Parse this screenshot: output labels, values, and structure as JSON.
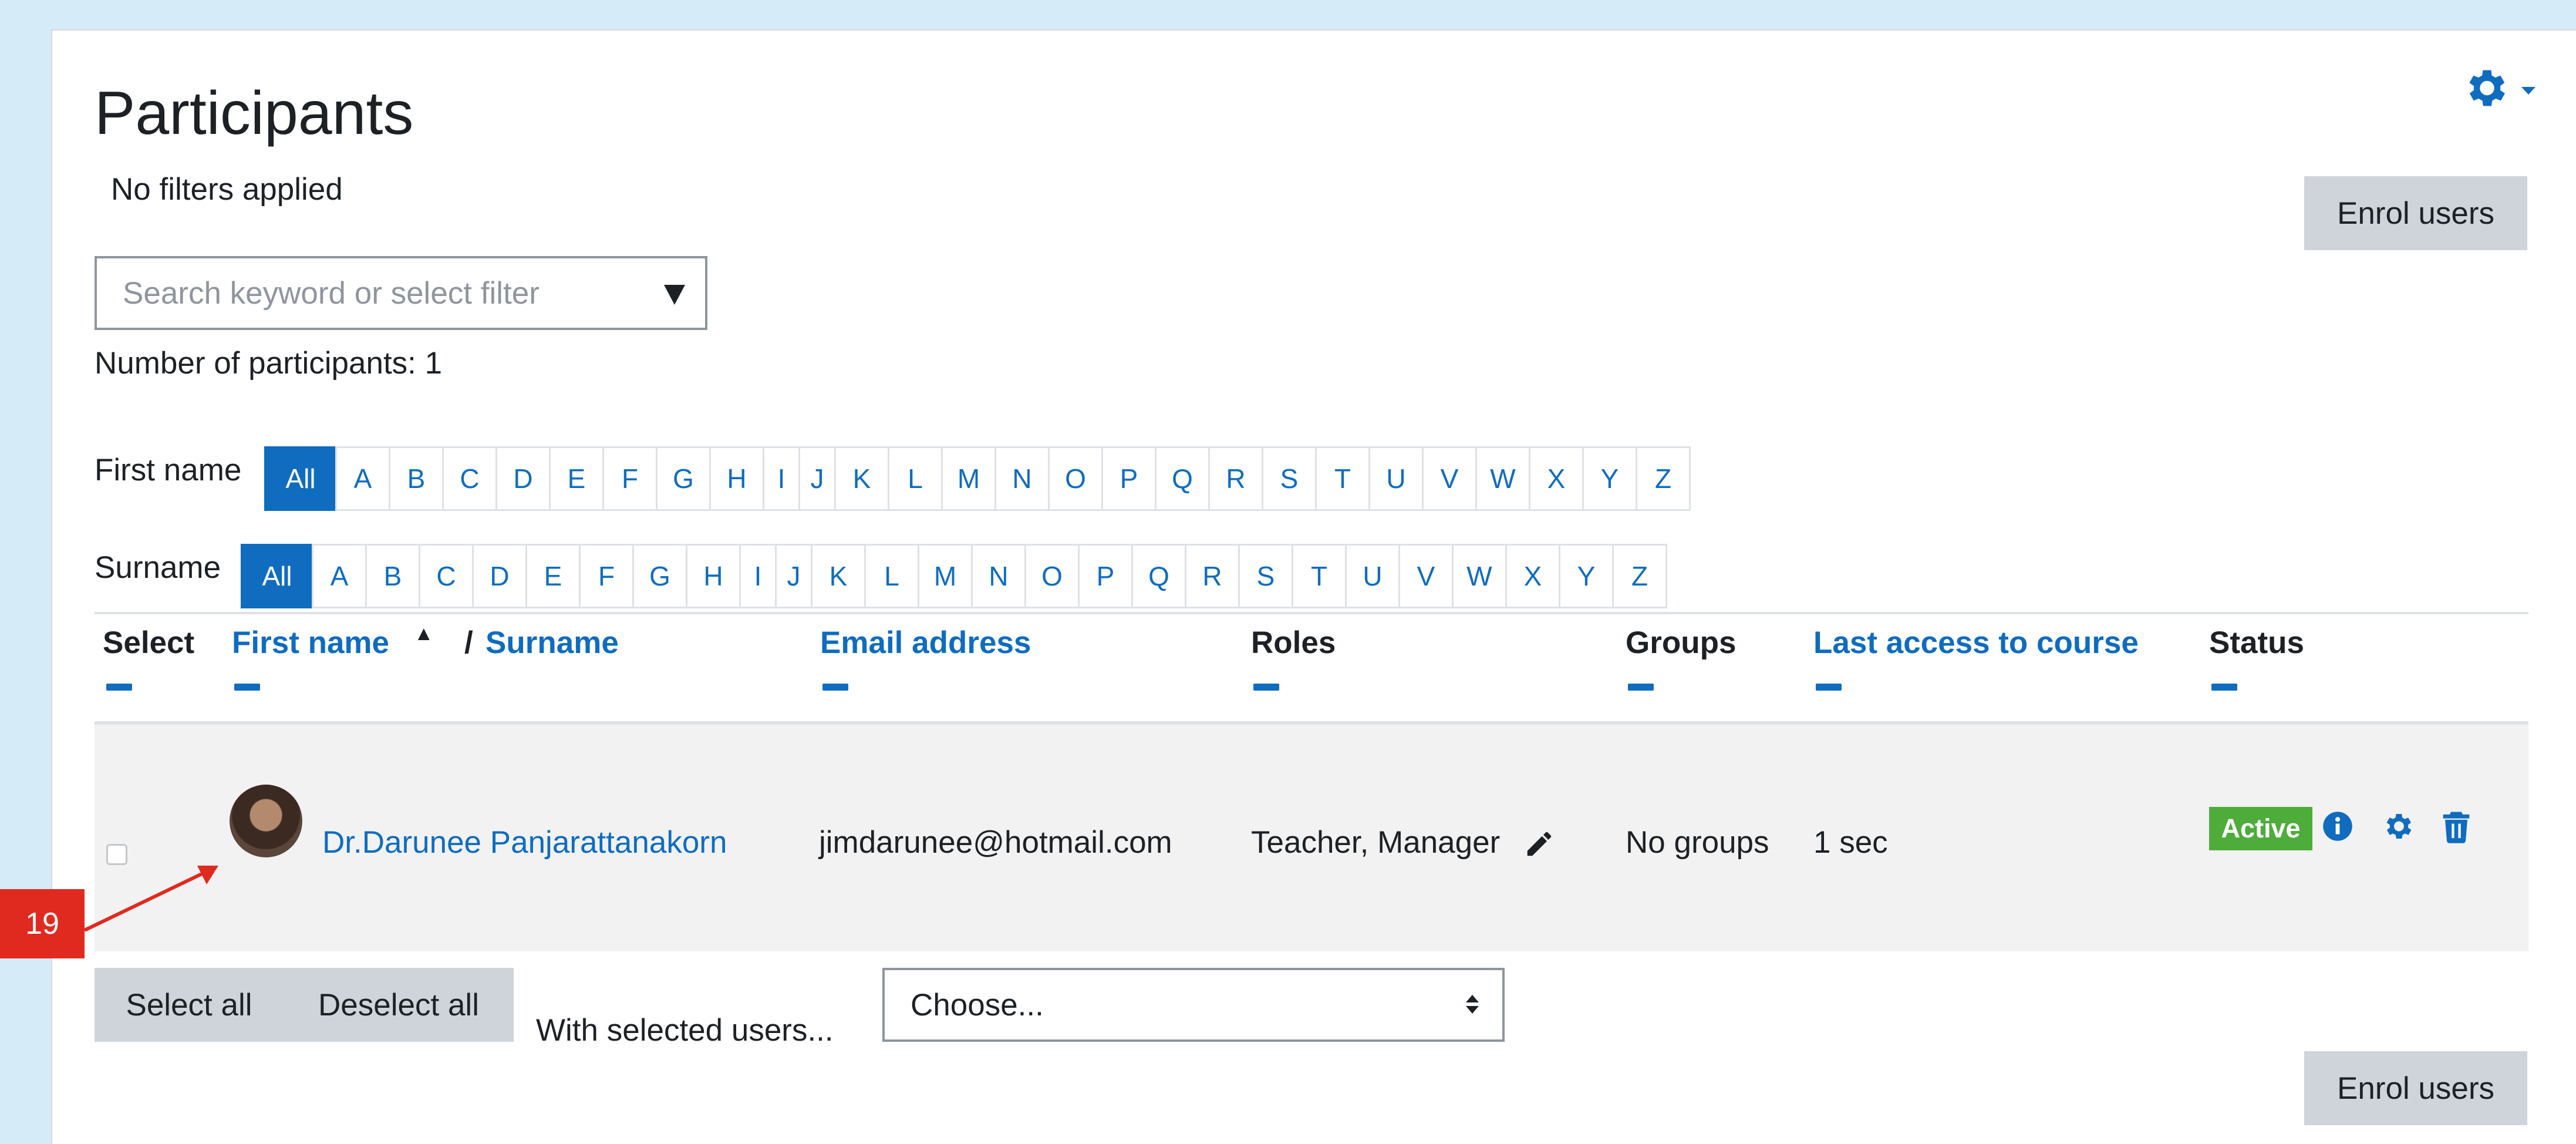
{
  "page": {
    "title": "Participants",
    "filter_status": "No filters applied",
    "enrol_button_label": "Enrol users",
    "search_placeholder": "Search keyword or select filter",
    "participant_count": "Number of participants: 1"
  },
  "initials_bar": {
    "first_name_label": "First name",
    "surname_label": "Surname",
    "all_label": "All",
    "letters": [
      "A",
      "B",
      "C",
      "D",
      "E",
      "F",
      "G",
      "H",
      "I",
      "J",
      "K",
      "L",
      "M",
      "N",
      "O",
      "P",
      "Q",
      "R",
      "S",
      "T",
      "U",
      "V",
      "W",
      "X",
      "Y",
      "Z"
    ]
  },
  "table": {
    "headers": {
      "select": "Select",
      "first_name": "First name",
      "sort_indicator": "▲",
      "surname_sep": "/",
      "surname": "Surname",
      "email": "Email address",
      "roles": "Roles",
      "groups": "Groups",
      "last_access": "Last access to course",
      "status": "Status"
    },
    "rows": [
      {
        "name": "Dr.Darunee Panjarattanakorn",
        "email": "jimdarunee@hotmail.com",
        "roles": "Teacher, Manager",
        "groups": "No groups",
        "last_access": "1 sec",
        "status": "Active"
      }
    ]
  },
  "bulk": {
    "select_all": "Select all",
    "deselect_all": "Deselect all",
    "with_selected": "With selected users...",
    "choose": "Choose..."
  },
  "annotation": {
    "number": "19"
  },
  "colors": {
    "link": "#0f6cbf",
    "active_badge": "#4eac3b",
    "annotation": "#e02a20",
    "button_grey": "#ced4da"
  },
  "icons": [
    "gear-icon",
    "pencil-icon",
    "info-icon",
    "cog-icon",
    "trash-icon",
    "sort-up-icon",
    "dropdown-arrow-icon"
  ]
}
